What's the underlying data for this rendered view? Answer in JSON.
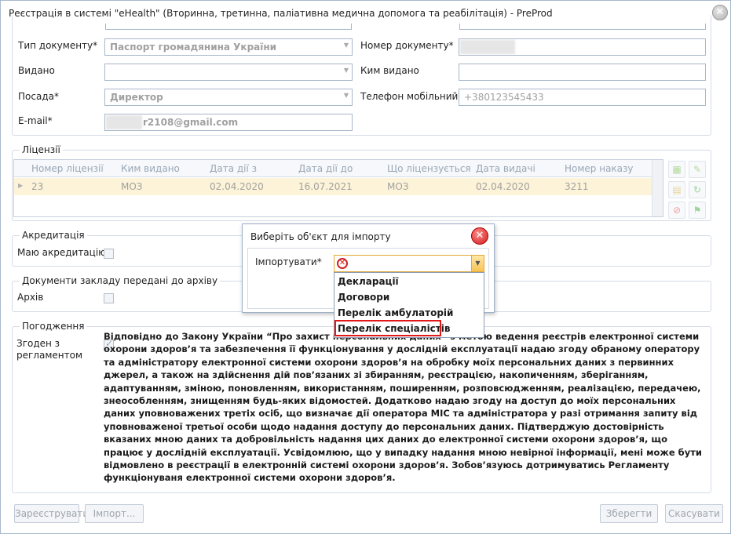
{
  "window": {
    "title": "Реєстрація в системі \"eHealth\" (Вторинна, третинна, паліативна медична допомога та реабілітація) - PreProd"
  },
  "form": {
    "doc_type_label": "Тип документу*",
    "doc_type_value": "Паспорт громадянина України",
    "doc_number_label": "Номер документу*",
    "doc_number_value": "",
    "issued_label": "Видано",
    "issued_value": "",
    "issued_by_label": "Ким видано",
    "issued_by_value": "",
    "position_label": "Посада*",
    "position_value": "Директор",
    "phone_label": "Телефон мобільний*",
    "phone_value": "+380123545433",
    "email_label": "E-mail*",
    "email_value": "r2108@gmail.com"
  },
  "licenses": {
    "legend": "Ліцензії",
    "columns": [
      "Номер ліцензії",
      "Ким видано",
      "Дата дії з",
      "Дата дії до",
      "Що ліцензується",
      "Дата видачі",
      "Номер наказу"
    ],
    "rows": [
      [
        "23",
        "МОЗ",
        "02.04.2020",
        "16.07.2021",
        "МОЗ",
        "02.04.2020",
        "3211"
      ]
    ]
  },
  "accreditation": {
    "legend": "Акредитація",
    "label": "Маю акредитацію",
    "checked": false
  },
  "archive": {
    "legend": "Документи закладу передані до архіву",
    "label": "Архів",
    "checked": false
  },
  "consent": {
    "legend": "Погодження",
    "label": "Згоден з регламентом",
    "checked": true,
    "text": "Відповідно до Закону України “Про захист персональних даних” з метою ведення реєстрів електронної системи охорони здоров’я та забезпечення її функціонування у дослідній експлуатації надаю згоду обраному оператору та адміністратору електронної системи охорони здоров’я на обробку моїх персональних даних з первинних джерел, а також на здійснення дій пов’язаних зі збиранням, реєстрацією, накопиченням, зберіганням, адаптуванням, зміною, поновленням, використанням, поширенням, розповсюдженням, реалізацією, передачею, знеособленням, знищенням будь-яких відомостей. Додатково надаю згоду на доступ до моїх персональних даних уповноважених третіх осіб, що визначає дії оператора МІС та адміністратора у разі отримання запиту від уповноваженої третьої особи щодо надання доступу до персональних даних. Підтверджую достовірність вказаних мною даних та добровільність надання цих даних до електронної системи охорони здоров’я, що працює у дослідній експлуатації. Усвідомлюю, що у випадку надання мною невірної інформації, мені може бути відмовлено в реєстрації в електронній системі охорони здоров’я. Зобов’язуюсь дотримуватись Регламенту функціонуваня електронної системи охорони здоров’я."
  },
  "buttons": {
    "register": "Зареєструвати",
    "import": "Імпорт...",
    "save": "Зберегти",
    "cancel": "Скасувати"
  },
  "import_dialog": {
    "title": "Виберіть об'єкт для імпорту",
    "field_label": "Імпортувати*",
    "options": [
      "Декларації",
      "Договори",
      "Перелік амбулаторій",
      "Перелік спеціалістів"
    ],
    "highlighted_option": "Перелік спеціалістів"
  },
  "colors": {
    "accent": "#e3a93c",
    "highlight": "#e01818",
    "row_selected": "#fdf3d8"
  }
}
